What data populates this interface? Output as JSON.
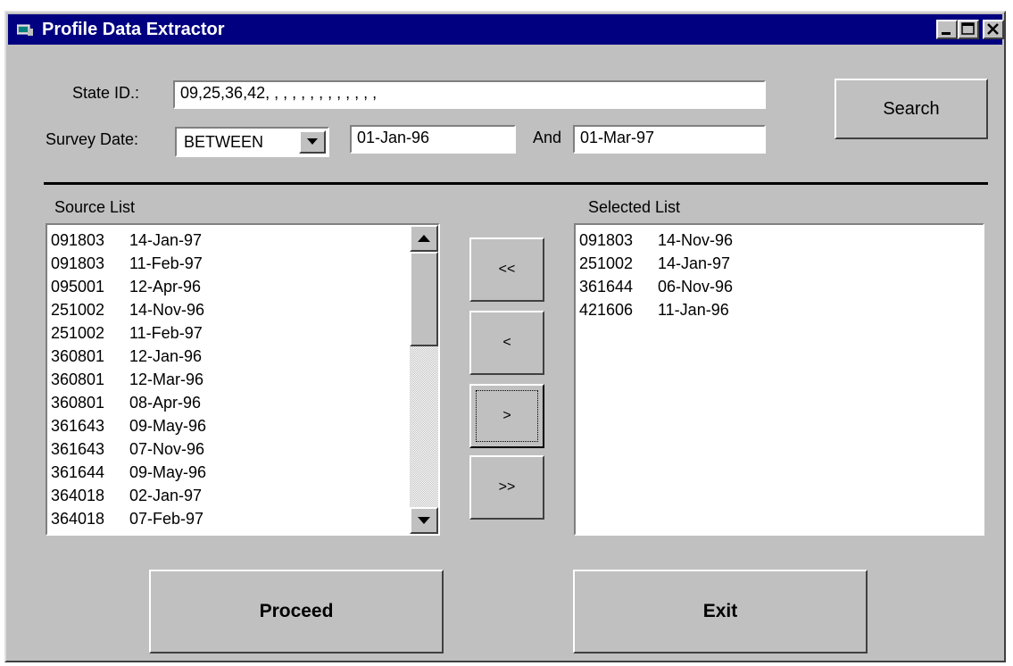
{
  "window": {
    "title": "Profile Data Extractor"
  },
  "form": {
    "state_label": "State ID.:",
    "state_value": "09,25,36,42, , , , , , , , , , , , ,",
    "survey_label": "Survey Date:",
    "operator": "BETWEEN",
    "date_from": "01-Jan-96",
    "and_label": "And",
    "date_to": "01-Mar-97",
    "search_label": "Search"
  },
  "source": {
    "label": "Source List",
    "items": [
      {
        "id": "091803",
        "date": "14-Jan-97"
      },
      {
        "id": "091803",
        "date": "11-Feb-97"
      },
      {
        "id": "095001",
        "date": "12-Apr-96"
      },
      {
        "id": "251002",
        "date": "14-Nov-96"
      },
      {
        "id": "251002",
        "date": "11-Feb-97"
      },
      {
        "id": "360801",
        "date": "12-Jan-96"
      },
      {
        "id": "360801",
        "date": "12-Mar-96"
      },
      {
        "id": "360801",
        "date": "08-Apr-96"
      },
      {
        "id": "361643",
        "date": "09-May-96"
      },
      {
        "id": "361643",
        "date": "07-Nov-96"
      },
      {
        "id": "361644",
        "date": "09-May-96"
      },
      {
        "id": "364018",
        "date": "02-Jan-97"
      },
      {
        "id": "364018",
        "date": "07-Feb-97"
      }
    ]
  },
  "selected": {
    "label": "Selected List",
    "items": [
      {
        "id": "091803",
        "date": "14-Nov-96"
      },
      {
        "id": "251002",
        "date": "14-Jan-97"
      },
      {
        "id": "361644",
        "date": "06-Nov-96"
      },
      {
        "id": "421606",
        "date": "11-Jan-96"
      }
    ]
  },
  "transfer": {
    "remove_all": "<<",
    "remove_one": "<",
    "add_one": ">",
    "add_all": ">>"
  },
  "actions": {
    "proceed": "Proceed",
    "exit": "Exit"
  },
  "colors": {
    "titlebar": "#000080",
    "face": "#c0c0c0"
  }
}
